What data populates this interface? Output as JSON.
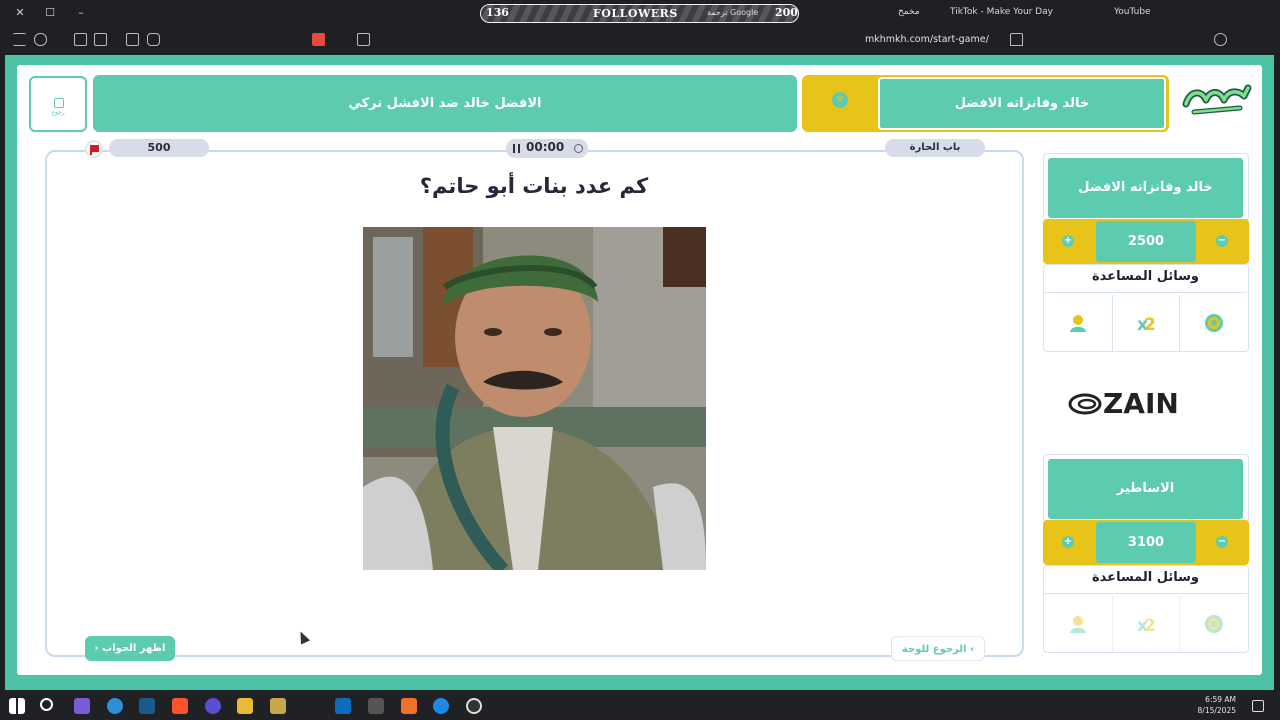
{
  "browser": {
    "followers": {
      "left_count": "136",
      "label": "FOLLOWERS",
      "translate": "ترجمة Google",
      "right_count": "200"
    },
    "tabs": [
      {
        "label": "مخمخ"
      },
      {
        "label": "TikTok - Make Your Day"
      },
      {
        "label": "YouTube"
      }
    ],
    "url": "mkhmkh.com/start-game/"
  },
  "header": {
    "back_label": "رجوع",
    "category_title": "الافضل خالد ضد الافشل تركي",
    "current_team": "خالد وفانزاته الافضل",
    "logo_text": "مخمخ"
  },
  "question_card": {
    "points": "500",
    "timer": "00:00",
    "category": "باب الحارة",
    "question": "كم عدد بنات أبو حاتم؟",
    "show_answer": "اظهر الجواب",
    "back_to_board": "الرجوع للوحة"
  },
  "teams": [
    {
      "name": "خالد وفانزاته الافضل",
      "score": "2500",
      "aids_title": "وسائل المساعدة",
      "plus": "+",
      "minus": "−",
      "aids": [
        "call-friend-icon",
        "double-points-icon",
        "hole-icon"
      ]
    },
    {
      "name": "الاساطير",
      "score": "3100",
      "aids_title": "وسائل المساعدة",
      "plus": "+",
      "minus": "−",
      "aids": [
        "call-friend-icon",
        "double-points-icon",
        "hole-icon"
      ]
    }
  ],
  "sponsor": {
    "name": "ZAIN"
  },
  "taskbar": {
    "time": "6:59 AM",
    "date": "8/15/2025"
  },
  "colors": {
    "teal": "#5ccbb0",
    "yellow": "#e8c319",
    "frame": "#4bc3a4"
  }
}
